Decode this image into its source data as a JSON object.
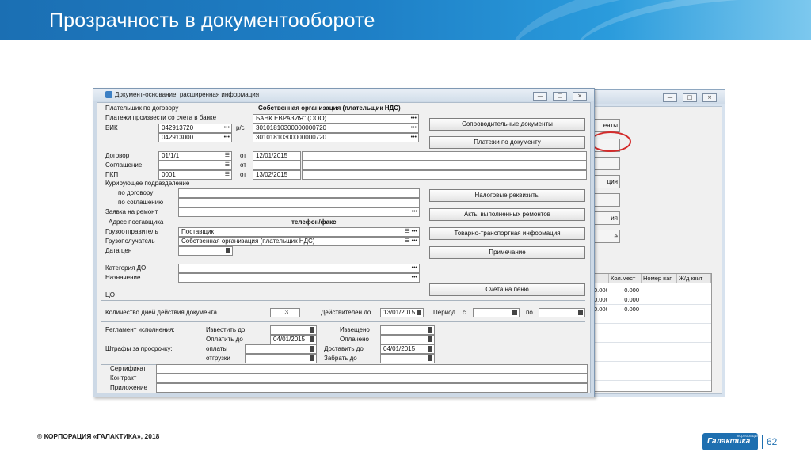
{
  "slide": {
    "title": "Прозрачность в документообороте",
    "footer": "© КОРПОРАЦИЯ «ГАЛАКТИКА», 2018",
    "logo": "Галактика",
    "logo_small": "корпорация",
    "page": "62",
    "accent_color": "#1e6fb0",
    "mark_color": "#d42a2a"
  },
  "bg_window": {
    "buttons": [
      "енты",
      "ция",
      "ия",
      "е"
    ],
    "columns": [
      "Кол.мест",
      "Номер ваг",
      "Ж/д квит"
    ],
    "rows": [
      [
        "0.000",
        "0.000"
      ],
      [
        "0.000",
        "0.000"
      ],
      [
        "0.000",
        "0.000"
      ]
    ]
  },
  "dialog": {
    "title": "Документ-основание: расширенная информация",
    "payer_label": "Плательщик по договору",
    "payer_value": "Собственная организация (плательщик НДС)",
    "pay_from_label": "Платежи произвести со счета в банке",
    "bank_value": "БАНК ЕВРАЗИЯ\" (ООО)",
    "bik_label": "БИК",
    "bik1": "042913720",
    "bik2": "042913000",
    "rs_label": "р/с",
    "rs1": "30101810300000000720",
    "rs2": "30101810300000000720",
    "contract_label": "Договор",
    "contract_value": "01/1/1",
    "from_label": "от",
    "contract_date": "12/01/2015",
    "agreement_label": "Соглашение",
    "pkp_label": "ПКП",
    "pkp_value": "0001",
    "pkp_date": "13/02/2015",
    "curator_label": "Курирующее подразделение",
    "by_contract_label": "по договору",
    "by_agreement_label": "по соглашению",
    "repair_request_label": "Заявка на ремонт",
    "supplier_address_label": "Адрес поставщика",
    "phone_label": "телефон/факс",
    "shipper_label": "Грузоотправитель",
    "shipper_value": "Поставщик",
    "consignee_label": "Грузополучатель",
    "consignee_value": "Собственная организация (плательщик НДС)",
    "price_date_label": "Дата цен",
    "do_category_label": "Категория ДО",
    "purpose_label": "Назначение",
    "co_label": "ЦО",
    "days_label": "Количество дней действия документа",
    "days_value": "3",
    "valid_until_label": "Действителен до",
    "valid_until_value": "13/01/2015",
    "period_label": "Период",
    "period_from_label": "с",
    "period_to_label": "по",
    "regulation_label": "Регламент исполнения:",
    "notify_by_label": "Известить до",
    "notified_label": "Извещено",
    "pay_by_label": "Оплатить до",
    "pay_by_value": "04/01/2015",
    "paid_label": "Оплачено",
    "penalties_label": "Штрафы за просрочку:",
    "payment_label": "оплаты",
    "shipment_label": "отгрузки",
    "deliver_by_label": "Доставить до",
    "deliver_by_value": "04/01/2015",
    "pickup_by_label": "Забрать до",
    "certificate_label": "Сертификат",
    "contract2_label": "Контракт",
    "appendix_label": "Приложение",
    "buttons": {
      "accompanying_docs": "Сопроводительные документы",
      "payments_by_doc": "Платежи по документу",
      "tax_details": "Налоговые реквизиты",
      "repair_acts": "Акты выполненных ремонтов",
      "transport_info": "Товарно-транспортная информация",
      "note": "Примечание",
      "invoices": "Счета на пеню"
    }
  }
}
